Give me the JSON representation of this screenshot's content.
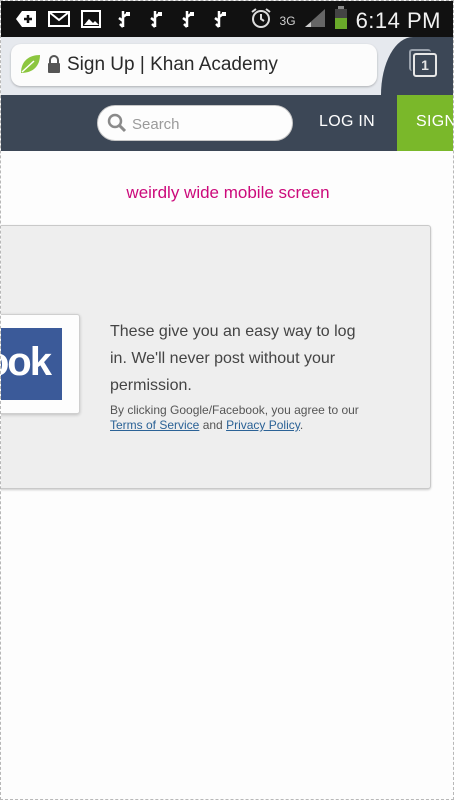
{
  "statusbar": {
    "time": "6:14 PM",
    "network": "3G",
    "left_icons": [
      "add-icon",
      "mail-icon",
      "image-icon",
      "usb-icon",
      "usb-icon",
      "usb-icon",
      "usb-icon"
    ]
  },
  "browser": {
    "page_title": "Sign Up | Khan Academy",
    "tab_count": "1"
  },
  "header": {
    "search_placeholder": "Search",
    "login_label": "LOG IN",
    "signup_label": "SIGN UP"
  },
  "main": {
    "subtitle": "weirdly wide mobile screen",
    "facebook_logo_text": "ook",
    "message": "These give you an easy way to log in. We'll never post without your permission.",
    "legal_prefix": "By clicking Google/Facebook, you agree to our ",
    "terms_link": "Terms of Service",
    "legal_and": " and ",
    "privacy_link": "Privacy Policy",
    "legal_suffix": "."
  },
  "colors": {
    "header_bg": "#3c4756",
    "signup_bg": "#7ab82a",
    "subtitle": "#cc0a7b",
    "facebook_blue": "#3b5a99",
    "link": "#2b6296"
  }
}
